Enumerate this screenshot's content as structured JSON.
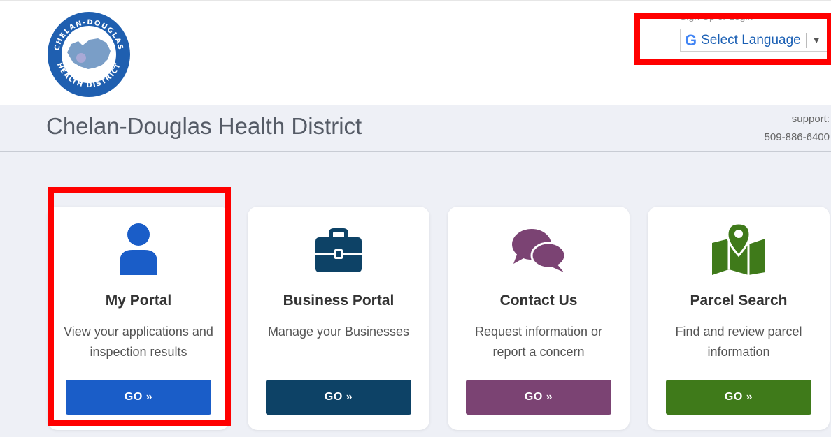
{
  "header": {
    "logo": {
      "top_text": "CHELAN-DOUGLAS",
      "bottom_text": "HEALTH DISTRICT"
    },
    "signin_text": "Sign Up or Login",
    "language": {
      "label": "Select Language",
      "icon": "google-g-icon"
    }
  },
  "titlebar": {
    "title": "Chelan-Douglas Health District",
    "support_label": "support:",
    "support_phone": "509-886-6400"
  },
  "cards": [
    {
      "icon": "user-icon",
      "title": "My Portal",
      "description": "View your applications and inspection results",
      "button": "GO »",
      "color": "#1a5dc8"
    },
    {
      "icon": "briefcase-icon",
      "title": "Business Portal",
      "description": "Manage your Businesses",
      "button": "GO »",
      "color": "#0d4266"
    },
    {
      "icon": "chat-bubbles-icon",
      "title": "Contact Us",
      "description": "Request information or report a concern",
      "button": "GO »",
      "color": "#7b4373"
    },
    {
      "icon": "map-pin-icon",
      "title": "Parcel Search",
      "description": "Find and review parcel information",
      "button": "GO »",
      "color": "#3f7a1a"
    }
  ],
  "colors": {
    "highlight": "#ff0000",
    "band_bg": "#eef0f6",
    "logo_blue": "#1f5fb0"
  }
}
